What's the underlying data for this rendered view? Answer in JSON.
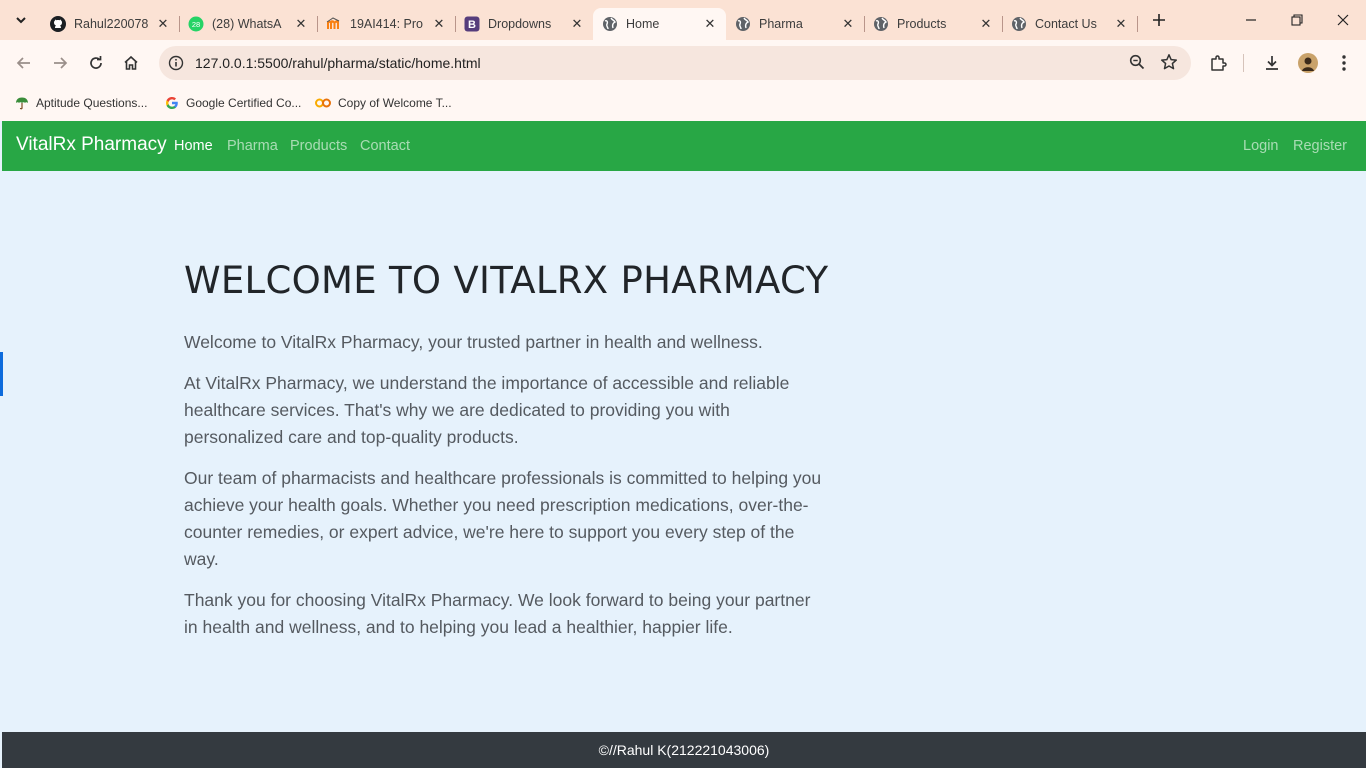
{
  "browser": {
    "tabs": [
      {
        "title": "Rahul220078",
        "icon": "github-icon"
      },
      {
        "title": "(28) WhatsA",
        "icon": "whatsapp-icon",
        "badge": "28"
      },
      {
        "title": "19AI414: Pro",
        "icon": "moodle-icon"
      },
      {
        "title": "Dropdowns",
        "icon": "bootstrap-icon"
      },
      {
        "title": "Home",
        "icon": "globe-icon",
        "active": true
      },
      {
        "title": "Pharma",
        "icon": "globe-icon"
      },
      {
        "title": "Products",
        "icon": "globe-icon"
      },
      {
        "title": "Contact Us",
        "icon": "globe-icon"
      }
    ],
    "url": "127.0.0.1:5500/rahul/pharma/static/home.html",
    "bookmarks": [
      {
        "label": "Aptitude Questions...",
        "icon": "umbrella-icon"
      },
      {
        "label": "Google Certified Co...",
        "icon": "google-icon"
      },
      {
        "label": "Copy of Welcome T...",
        "icon": "colab-icon"
      }
    ]
  },
  "site": {
    "brand": "VitalRx Pharmacy",
    "nav": {
      "home": "Home",
      "pharma": "Pharma",
      "products": "Products",
      "contact": "Contact",
      "login": "Login",
      "register": "Register"
    },
    "heading": "WELCOME TO VITALRX PHARMACY",
    "paragraphs": [
      "Welcome to VitalRx Pharmacy, your trusted partner in health and wellness.",
      "At VitalRx Pharmacy, we understand the importance of accessible and reliable healthcare services. That's why we are dedicated to providing you with personalized care and top-quality products.",
      "Our team of pharmacists and healthcare professionals is committed to helping you achieve your health goals. Whether you need prescription medications, over-the-counter remedies, or expert advice, we're here to support you every step of the way.",
      "Thank you for choosing VitalRx Pharmacy. We look forward to being your partner in health and wellness, and to helping you lead a healthier, happier life."
    ],
    "footer": "©//Rahul K(212221043006)"
  },
  "colors": {
    "navbar": "#28a745",
    "page_bg": "#e6f2fc",
    "footer_bg": "#343a40",
    "tabbar_bg": "#fbe2d4"
  }
}
